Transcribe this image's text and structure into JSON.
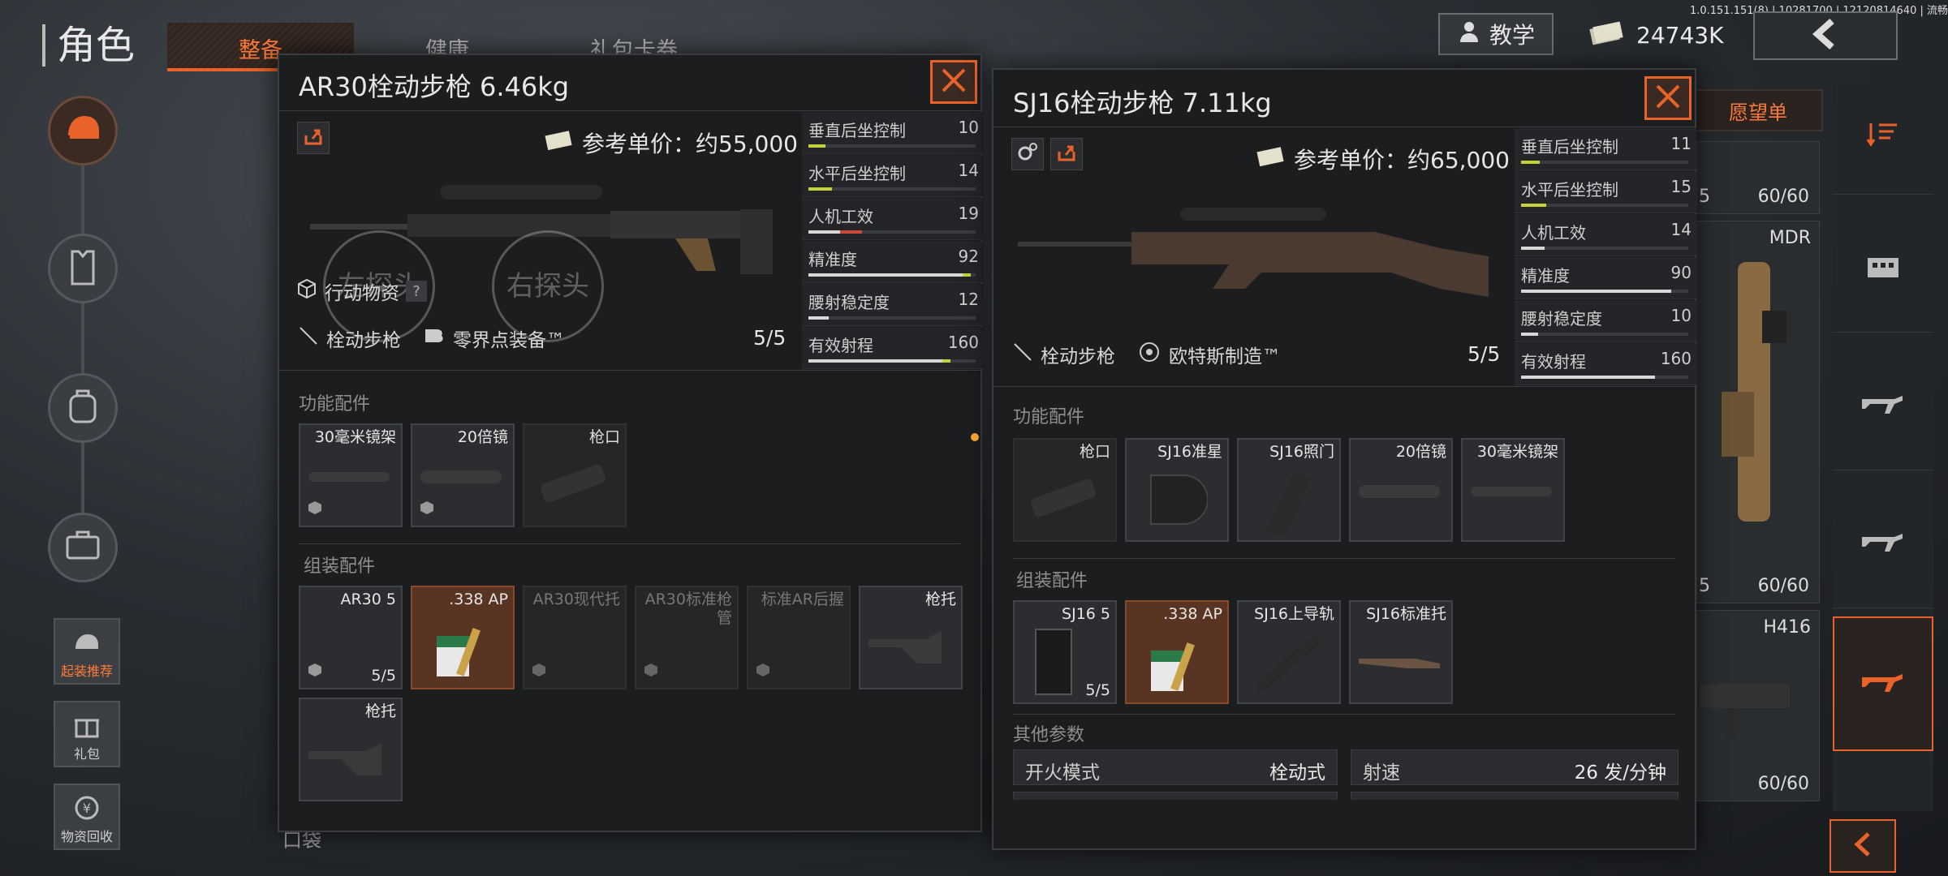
{
  "header": {
    "title": "角色",
    "tabs": [
      "整备",
      "健康",
      "礼包卡券"
    ],
    "teach_label": "教学",
    "money": "24743K",
    "version": "1.0.151.151(8) | 10281700 | 12120814640 | 流畅"
  },
  "sidebar": {
    "buttons": [
      {
        "label": "起装推荐"
      },
      {
        "label": "礼包"
      },
      {
        "label": "物资回收"
      }
    ]
  },
  "behind": {
    "wishlist_label": "愿望单",
    "bottom_label": "口袋",
    "cards": [
      {
        "name": "",
        "count": "60/60",
        "left": "5"
      },
      {
        "name": "MDR",
        "count": "60/60",
        "left": "5"
      },
      {
        "name": "H416",
        "count": "60/60",
        "left": ""
      }
    ]
  },
  "panel_left": {
    "title": "AR30栓动步枪 6.46kg",
    "price": "参考单价：约55,000",
    "action_tag": "行动物资",
    "help": "?",
    "probe_left": "左探头",
    "probe_right": "右探头",
    "type": "栓动步枪",
    "maker": "零界点装备™",
    "durability": "5/5",
    "stats": [
      {
        "label": "垂直后坐控制",
        "value": "10",
        "fill": 0.1,
        "color": "#c6d23a"
      },
      {
        "label": "水平后坐控制",
        "value": "14",
        "fill": 0.14,
        "color": "#c6d23a"
      },
      {
        "label": "人机工效",
        "value": "19",
        "fill": 0.19,
        "color": "#d8d8d8",
        "neg": 0.13,
        "negcolor": "#c84a3a"
      },
      {
        "label": "精准度",
        "value": "92",
        "fill": 0.92,
        "color": "#d8d8d8",
        "pos": 0.05,
        "poscolor": "#c6d23a"
      },
      {
        "label": "腰射稳定度",
        "value": "12",
        "fill": 0.12,
        "color": "#d8d8d8"
      },
      {
        "label": "有效射程",
        "value": "160",
        "fill": 0.8,
        "color": "#d8d8d8",
        "pos": 0.05,
        "poscolor": "#c6d23a"
      }
    ],
    "func_label": "功能配件",
    "func_slots": [
      {
        "label": "30毫米镜架"
      },
      {
        "label": "20倍镜"
      },
      {
        "label": "枪口"
      }
    ],
    "asm_label": "组装配件",
    "asm_slots": [
      {
        "label": "AR30 5",
        "count": "5/5"
      },
      {
        "label": ".338 AP"
      },
      {
        "label": "AR30现代托"
      },
      {
        "label": "AR30标准枪管"
      },
      {
        "label": "标准AR后握"
      },
      {
        "label": "枪托"
      },
      {
        "label": "枪托"
      }
    ]
  },
  "panel_right": {
    "title": "SJ16栓动步枪 7.11kg",
    "price": "参考单价：约65,000",
    "type": "栓动步枪",
    "maker": "欧特斯制造™",
    "durability": "5/5",
    "stats": [
      {
        "label": "垂直后坐控制",
        "value": "11",
        "fill": 0.11,
        "color": "#c6d23a"
      },
      {
        "label": "水平后坐控制",
        "value": "15",
        "fill": 0.15,
        "color": "#c6d23a"
      },
      {
        "label": "人机工效",
        "value": "14",
        "fill": 0.14,
        "color": "#d8d8d8",
        "neg": 0.0
      },
      {
        "label": "精准度",
        "value": "90",
        "fill": 0.9,
        "color": "#d8d8d8"
      },
      {
        "label": "腰射稳定度",
        "value": "10",
        "fill": 0.1,
        "color": "#d8d8d8"
      },
      {
        "label": "有效射程",
        "value": "160",
        "fill": 0.8,
        "color": "#d8d8d8"
      }
    ],
    "func_label": "功能配件",
    "func_slots": [
      {
        "label": "枪口"
      },
      {
        "label": "SJ16准星"
      },
      {
        "label": "SJ16照门"
      },
      {
        "label": "20倍镜"
      },
      {
        "label": "30毫米镜架"
      }
    ],
    "asm_label": "组装配件",
    "asm_slots": [
      {
        "label": "SJ16 5",
        "count": "5/5"
      },
      {
        "label": ".338 AP"
      },
      {
        "label": "SJ16上导轨"
      },
      {
        "label": "SJ16标准托"
      }
    ],
    "other_label": "其他参数",
    "params": [
      {
        "label": "开火模式",
        "value": "栓动式"
      },
      {
        "label": "射速",
        "value": "26 发/分钟"
      }
    ]
  }
}
